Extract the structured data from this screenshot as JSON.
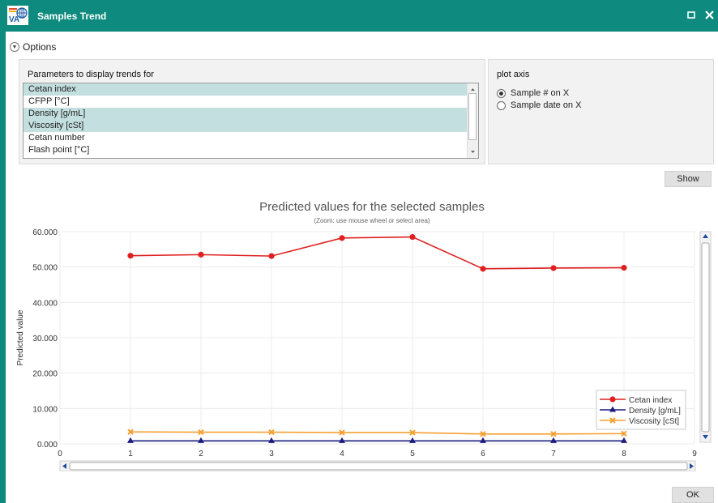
{
  "window": {
    "title": "Samples Trend"
  },
  "options": {
    "label": "Options"
  },
  "params_panel": {
    "title": "Parameters to display trends for",
    "items": [
      {
        "label": "Cetan index",
        "selected": true
      },
      {
        "label": "CFPP [°C]",
        "selected": false
      },
      {
        "label": "Density [g/mL]",
        "selected": true
      },
      {
        "label": "Viscosity [cSt]",
        "selected": true
      },
      {
        "label": "Cetan number",
        "selected": false
      },
      {
        "label": "Flash point [°C]",
        "selected": false
      }
    ]
  },
  "axis_panel": {
    "title": "plot axis",
    "options": [
      {
        "label": "Sample # on X",
        "checked": true
      },
      {
        "label": "Sample date on X",
        "checked": false
      }
    ]
  },
  "buttons": {
    "show": "Show",
    "ok": "OK"
  },
  "colors": {
    "titlebar": "#0e8a7e",
    "selection": "#c3dfe0"
  },
  "chart_data": {
    "type": "line",
    "title": "Predicted values for the selected samples",
    "subtitle": "(Zoom: use mouse wheel or select area)",
    "ylabel": "Predicted value",
    "xlabel": "",
    "xlim": [
      0,
      9
    ],
    "ylim": [
      0,
      60
    ],
    "x_ticks": [
      "0",
      "1",
      "2",
      "3",
      "4",
      "5",
      "6",
      "7",
      "8",
      "9"
    ],
    "y_ticks": [
      "0.000",
      "10.000",
      "20.000",
      "30.000",
      "40.000",
      "50.000",
      "60.000"
    ],
    "grid": true,
    "legend_position": "bottom-right",
    "x": [
      1,
      2,
      3,
      4,
      5,
      6,
      7,
      8
    ],
    "series": [
      {
        "name": "Cetan index",
        "color": "#e02020",
        "marker": "circle",
        "values": [
          53.2,
          53.5,
          53.1,
          58.2,
          58.5,
          49.5,
          49.7,
          49.8
        ]
      },
      {
        "name": "Density [g/mL]",
        "color": "#1c1c80",
        "marker": "triangle",
        "values": [
          0.84,
          0.84,
          0.84,
          0.84,
          0.84,
          0.84,
          0.84,
          0.84
        ]
      },
      {
        "name": "Viscosity [cSt]",
        "color": "#f5a030",
        "marker": "x",
        "values": [
          3.4,
          3.3,
          3.3,
          3.2,
          3.2,
          2.8,
          2.8,
          2.9
        ]
      }
    ]
  }
}
